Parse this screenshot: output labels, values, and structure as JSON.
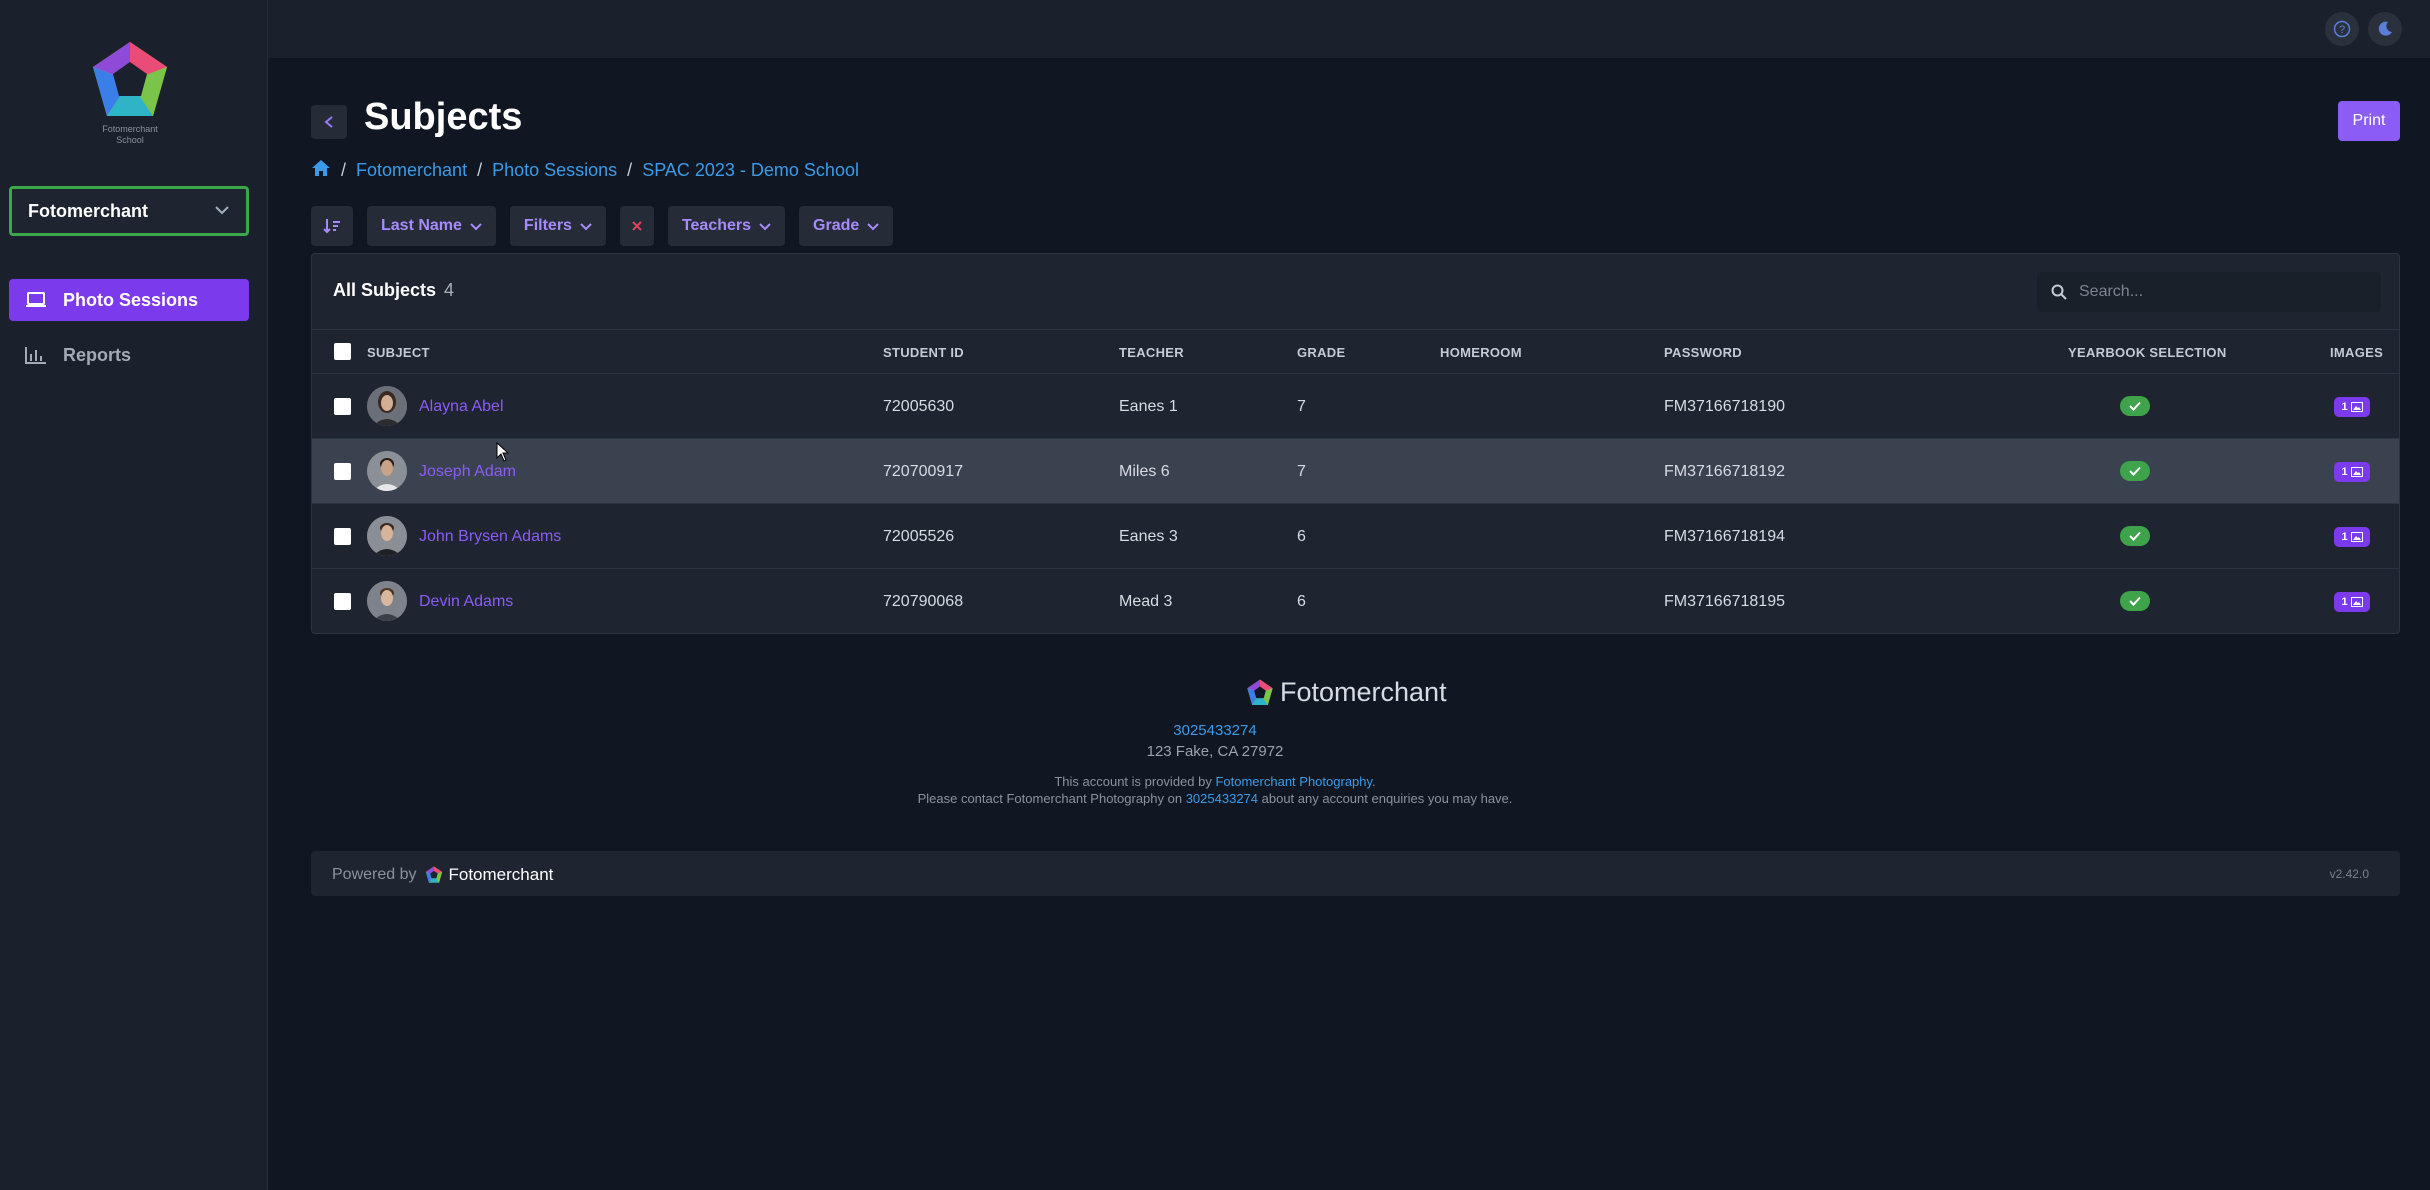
{
  "app": {
    "logo_text_line1": "Fotomerchant",
    "logo_text_line2": "School"
  },
  "sidebar": {
    "org_selector": {
      "label": "Fotomerchant"
    },
    "items": [
      {
        "label": "Photo Sessions",
        "icon": "laptop-icon",
        "active": true
      },
      {
        "label": "Reports",
        "icon": "bar-chart-icon",
        "active": false
      }
    ]
  },
  "header": {
    "title": "Subjects",
    "print_label": "Print"
  },
  "breadcrumb": [
    "Fotomerchant",
    "Photo Sessions",
    "SPAC 2023 - Demo School"
  ],
  "filters": {
    "sort_label": "Last Name",
    "filters_label": "Filters",
    "teachers_label": "Teachers",
    "grade_label": "Grade"
  },
  "panel": {
    "title": "All Subjects",
    "count": "4",
    "search_placeholder": "Search..."
  },
  "table": {
    "columns": {
      "subject": "SUBJECT",
      "student_id": "STUDENT ID",
      "teacher": "TEACHER",
      "grade": "GRADE",
      "homeroom": "HOMEROOM",
      "password": "PASSWORD",
      "yearbook": "YEARBOOK SELECTION",
      "images": "IMAGES"
    },
    "rows": [
      {
        "name": "Alayna Abel",
        "student_id": "72005630",
        "teacher": "Eanes 1",
        "grade": "7",
        "homeroom": "",
        "password": "FM37166718190",
        "images": "1"
      },
      {
        "name": "Joseph Adam",
        "student_id": "720700917",
        "teacher": "Miles 6",
        "grade": "7",
        "homeroom": "",
        "password": "FM37166718192",
        "images": "1"
      },
      {
        "name": "John Brysen Adams",
        "student_id": "72005526",
        "teacher": "Eanes 3",
        "grade": "6",
        "homeroom": "",
        "password": "FM37166718194",
        "images": "1"
      },
      {
        "name": "Devin Adams",
        "student_id": "720790068",
        "teacher": "Mead 3",
        "grade": "6",
        "homeroom": "",
        "password": "FM37166718195",
        "images": "1"
      }
    ]
  },
  "footer": {
    "brand": "Fotomerchant",
    "phone": "3025433274",
    "address": "123 Fake, CA 27972",
    "provided_prefix": "This account is provided by ",
    "provider": "Fotomerchant Photography",
    "provided_suffix": ".",
    "contact_prefix": "Please contact Fotomerchant Photography on ",
    "contact_phone": "3025433274",
    "contact_suffix": " about any account enquiries you may have.",
    "powered_by": "Powered by",
    "powered_brand": "Fotomerchant",
    "version": "v2.42.0"
  },
  "colors": {
    "accent": "#8b5cf6",
    "link": "#3b9be8",
    "success": "#3ea34b",
    "org_border": "#38a84a"
  }
}
